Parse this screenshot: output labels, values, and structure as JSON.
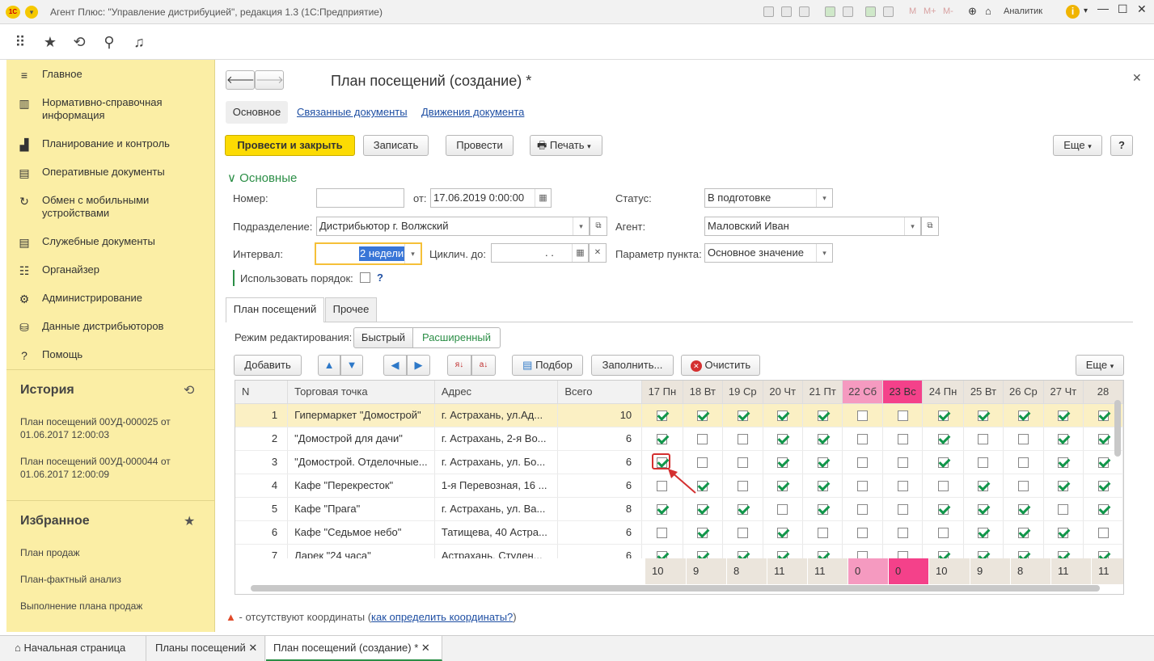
{
  "window": {
    "logo": "1С",
    "title": "Агент Плюс: \"Управление дистрибуцией\", редакция 1.3  (1С:Предприятие)",
    "toolbar_text": [
      "M",
      "M+",
      "M-"
    ],
    "user": "Аналитик",
    "info": "i"
  },
  "sidebar": {
    "items": [
      {
        "icon": "≡",
        "label": "Главное"
      },
      {
        "icon": "▥",
        "label": "Нормативно-справочная информация"
      },
      {
        "icon": "▟",
        "label": "Планирование и контроль"
      },
      {
        "icon": "▤",
        "label": "Оперативные документы"
      },
      {
        "icon": "↻",
        "label": "Обмен с мобильными устройствами"
      },
      {
        "icon": "▤",
        "label": "Служебные документы"
      },
      {
        "icon": "☷",
        "label": "Органайзер"
      },
      {
        "icon": "⚙",
        "label": "Администрирование"
      },
      {
        "icon": "⛁",
        "label": "Данные дистрибьюторов"
      },
      {
        "icon": "?",
        "label": "Помощь"
      }
    ],
    "history_title": "История",
    "history": [
      "План посещений 00УД-000025 от 01.06.2017 12:00:03",
      "План посещений 00УД-000044 от 01.06.2017 12:00:09"
    ],
    "favorites_title": "Избранное",
    "favorites": [
      "План продаж",
      "План-фактный анализ",
      "Выполнение плана продаж"
    ]
  },
  "form": {
    "title": "План посещений  (создание) *",
    "nav_tabs": [
      "Основное",
      "Связанные документы",
      "Движения документа"
    ],
    "buttons": {
      "post_close": "Провести и закрыть",
      "save": "Записать",
      "post": "Провести",
      "print": "Печать",
      "more": "Еще",
      "help": "?"
    },
    "section": "Основные",
    "fields": {
      "number_label": "Номер:",
      "number_value": "",
      "from_label": "от:",
      "from_value": "17.06.2019  0:00:00",
      "status_label": "Статус:",
      "status_value": "В подготовке",
      "division_label": "Подразделение:",
      "division_value": "Дистрибьютор г. Волжский",
      "agent_label": "Агент:",
      "agent_value": "Маловский Иван",
      "interval_label": "Интервал:",
      "interval_value": "2 недели",
      "cycle_label": "Циклич. до:",
      "cycle_value": ".   .",
      "param_label": "Параметр пункта:",
      "param_value": "Основное значение",
      "order_label": "Использовать порядок:",
      "order_help": "?"
    },
    "inner_tabs": [
      "План посещений",
      "Прочее"
    ],
    "edit_mode_label": "Режим редактирования:",
    "edit_modes": [
      "Быстрый",
      "Расширенный"
    ],
    "table_buttons": {
      "add": "Добавить",
      "pick": "Подбор",
      "fill": "Заполнить...",
      "clear": "Очистить",
      "more": "Еще"
    },
    "columns": {
      "n": "N",
      "point": "Торговая точка",
      "address": "Адрес",
      "total": "Всего",
      "days": [
        "17 Пн",
        "18 Вт",
        "19 Ср",
        "20 Чт",
        "21 Пт",
        "22 Сб",
        "23 Вс",
        "24 Пн",
        "25 Вт",
        "26 Ср",
        "27 Чт",
        "28"
      ]
    },
    "rows": [
      {
        "n": "1",
        "point": "Гипермаркет \"Домострой\"",
        "address": "г. Астрахань, ул.Ад...",
        "total": "10",
        "checks": [
          1,
          1,
          1,
          1,
          1,
          0,
          0,
          1,
          1,
          1,
          1,
          1
        ]
      },
      {
        "n": "2",
        "point": "\"Домострой для дачи\"",
        "address": "г. Астрахань, 2-я Во...",
        "total": "6",
        "checks": [
          1,
          0,
          0,
          1,
          1,
          0,
          0,
          1,
          0,
          0,
          1,
          1
        ]
      },
      {
        "n": "3",
        "point": "\"Домострой. Отделочные...",
        "address": "г. Астрахань, ул. Бо...",
        "total": "6",
        "checks": [
          1,
          0,
          0,
          1,
          1,
          0,
          0,
          1,
          0,
          0,
          1,
          1
        ]
      },
      {
        "n": "4",
        "point": "Кафе \"Перекресток\"",
        "address": "1-я Перевозная, 16 ...",
        "total": "6",
        "checks": [
          0,
          1,
          0,
          1,
          1,
          0,
          0,
          0,
          1,
          0,
          1,
          1
        ]
      },
      {
        "n": "5",
        "point": "Кафе \"Прага\"",
        "address": "г. Астрахань, ул. Ва...",
        "total": "8",
        "checks": [
          1,
          1,
          1,
          0,
          1,
          0,
          0,
          1,
          1,
          1,
          0,
          1
        ]
      },
      {
        "n": "6",
        "point": "Кафе \"Седьмое небо\"",
        "address": "Татищева, 40 Астра...",
        "total": "6",
        "checks": [
          0,
          1,
          0,
          1,
          0,
          0,
          0,
          0,
          1,
          1,
          1,
          0
        ]
      },
      {
        "n": "7",
        "point": "Ларек \"24 часа\"",
        "address": "Астрахань, Студен...",
        "total": "6",
        "checks": [
          1,
          1,
          1,
          1,
          1,
          0,
          0,
          1,
          1,
          1,
          1,
          1
        ]
      }
    ],
    "totals": [
      "10",
      "9",
      "8",
      "11",
      "11",
      "0",
      "0",
      "10",
      "9",
      "8",
      "11",
      "11"
    ],
    "footnote": "- отсутствуют координаты (",
    "footnote_link": "как определить координаты?",
    "footnote_end": ")"
  },
  "bottom_tabs": [
    "Начальная страница",
    "Планы посещений",
    "План посещений  (создание) *"
  ],
  "colors": {
    "accent": "#fcdb03",
    "sidebar": "#fbeea5",
    "weekend_sat": "#f59ac0",
    "weekend_sun": "#f4418a",
    "check": "#11964a"
  }
}
